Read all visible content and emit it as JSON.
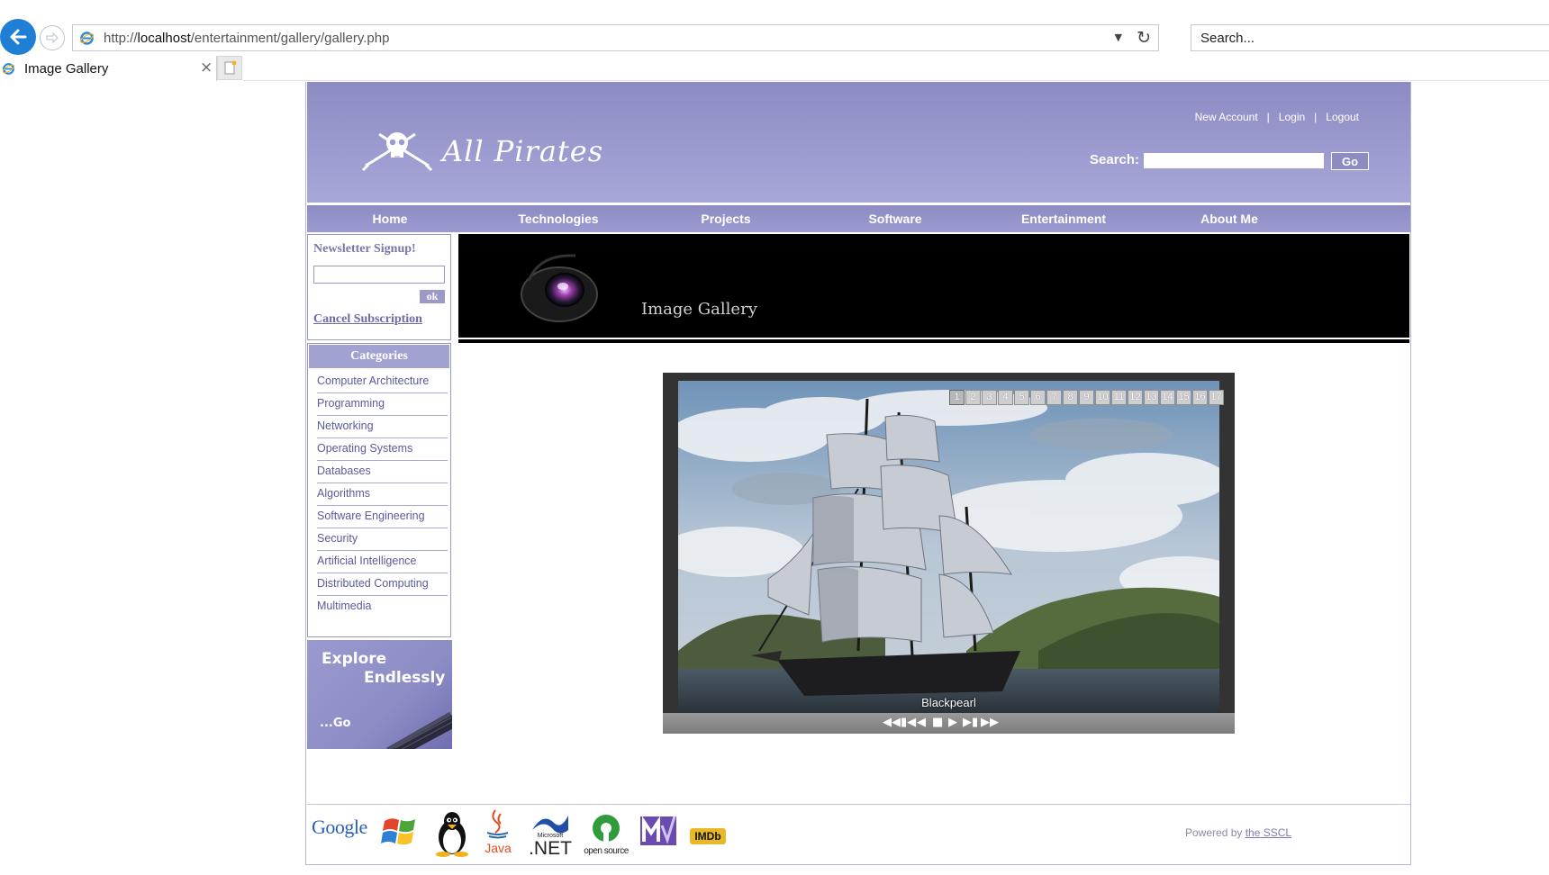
{
  "browser": {
    "url_prefix": "http://",
    "url_host": "localhost",
    "url_path": "/entertainment/gallery/gallery.php",
    "search_placeholder": "Search...",
    "tab_title": "Image Gallery",
    "tab_close": "×"
  },
  "header": {
    "logo_text": "All Pirates",
    "links": {
      "new_account": "New Account",
      "login": "Login",
      "logout": "Logout",
      "separator": "|"
    },
    "search_label": "Search:",
    "search_button": "Go"
  },
  "nav": {
    "items": [
      {
        "label": "Home"
      },
      {
        "label": "Technologies"
      },
      {
        "label": "Projects"
      },
      {
        "label": "Software"
      },
      {
        "label": "Entertainment"
      },
      {
        "label": "About Me"
      }
    ]
  },
  "sidebar": {
    "newsletter_title": "Newsletter Signup!",
    "newsletter_button": "ok",
    "cancel_link": "Cancel Subscription",
    "categories_title": "Categories",
    "categories": [
      "Computer Architecture",
      "Programming",
      "Networking",
      "Operating Systems",
      "Databases",
      "Algorithms",
      "Software Engineering",
      "Security",
      "Artificial Intelligence",
      "Distributed Computing",
      "Multimedia"
    ],
    "explore_line1": "Explore",
    "explore_line2": "Endlessly",
    "explore_go": "...Go"
  },
  "gallery": {
    "banner_title": "Image Gallery",
    "caption": "Blackpearl",
    "active_thumb": 1,
    "thumbs": [
      "1",
      "2",
      "3",
      "4",
      "5",
      "6",
      "7",
      "8",
      "9",
      "10",
      "11",
      "12",
      "13",
      "14",
      "15",
      "16",
      "17"
    ]
  },
  "footer": {
    "logos": [
      "Google",
      "Windows",
      "Linux",
      "Java",
      "Microsoft .NET",
      "open source",
      "MTV",
      "IMDb"
    ],
    "logo_texts": {
      "google": "Google",
      "java": "Java",
      "net_small": "Microsoft",
      "net_big": ".NET",
      "opensource": "open source",
      "imdb": "IMDb"
    },
    "powered_by": "Powered by",
    "powered_link": "the SSCL"
  },
  "colors": {
    "header_purple": "#8c8cc3",
    "link_purple": "#6b6ba8",
    "browser_blue": "#1e7fd4"
  }
}
